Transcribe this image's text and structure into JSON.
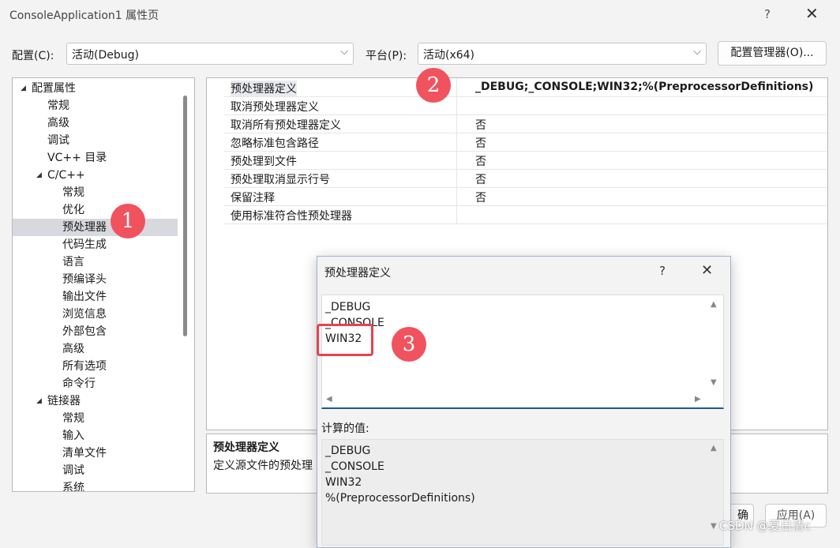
{
  "window": {
    "title": "ConsoleApplication1 属性页",
    "help": "?",
    "close": "✕"
  },
  "config": {
    "config_label": "配置(C):",
    "config_value": "活动(Debug)",
    "platform_label": "平台(P):",
    "platform_value": "活动(x64)",
    "manager_button": "配置管理器(O)..."
  },
  "tree": [
    {
      "label": "配置属性",
      "level": 0,
      "expanded": true
    },
    {
      "label": "常规",
      "level": 1
    },
    {
      "label": "高级",
      "level": 1
    },
    {
      "label": "调试",
      "level": 1
    },
    {
      "label": "VC++ 目录",
      "level": 1
    },
    {
      "label": "C/C++",
      "level": 1,
      "expanded": true
    },
    {
      "label": "常规",
      "level": 2
    },
    {
      "label": "优化",
      "level": 2
    },
    {
      "label": "预处理器",
      "level": 2,
      "selected": true
    },
    {
      "label": "代码生成",
      "level": 2
    },
    {
      "label": "语言",
      "level": 2
    },
    {
      "label": "预编译头",
      "level": 2
    },
    {
      "label": "输出文件",
      "level": 2
    },
    {
      "label": "浏览信息",
      "level": 2
    },
    {
      "label": "外部包含",
      "level": 2
    },
    {
      "label": "高级",
      "level": 2
    },
    {
      "label": "所有选项",
      "level": 2
    },
    {
      "label": "命令行",
      "level": 2
    },
    {
      "label": "链接器",
      "level": 1,
      "expanded": true
    },
    {
      "label": "常规",
      "level": 2
    },
    {
      "label": "输入",
      "level": 2
    },
    {
      "label": "清单文件",
      "level": 2
    },
    {
      "label": "调试",
      "level": 2
    },
    {
      "label": "系统",
      "level": 2
    }
  ],
  "properties": [
    {
      "name": "预处理器定义",
      "value": "_DEBUG;_CONSOLE;WIN32;%(PreprocessorDefinitions)"
    },
    {
      "name": "取消预处理器定义",
      "value": ""
    },
    {
      "name": "取消所有预处理器定义",
      "value": "否"
    },
    {
      "name": "忽略标准包含路径",
      "value": "否"
    },
    {
      "name": "预处理到文件",
      "value": "否"
    },
    {
      "name": "预处理取消显示行号",
      "value": "否"
    },
    {
      "name": "保留注释",
      "value": "否"
    },
    {
      "name": "使用标准符合性预处理器",
      "value": ""
    }
  ],
  "description": {
    "title": "预处理器定义",
    "text": "定义源文件的预处理"
  },
  "dialog": {
    "title": "预处理器定义",
    "help": "?",
    "close": "✕",
    "edit_lines": [
      "_DEBUG",
      "_CONSOLE",
      "WIN32"
    ],
    "computed_label": "计算的值:",
    "computed_lines": [
      "_DEBUG",
      "_CONSOLE",
      "WIN32",
      "%(PreprocessorDefinitions)"
    ]
  },
  "bottom_buttons": {
    "ok_partial": "确",
    "apply": "应用(A)"
  },
  "markers": [
    "1",
    "2",
    "3"
  ],
  "watermark": "CSDN @夏日清c",
  "colors": {
    "marker": "#f0535e",
    "highlight_box": "#e7424f",
    "selected_row": "#d7d9df"
  }
}
